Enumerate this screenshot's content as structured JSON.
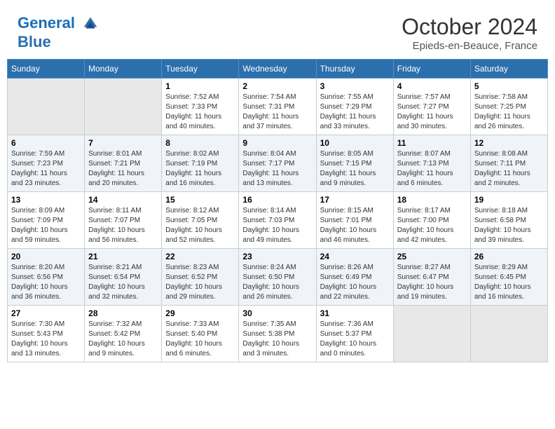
{
  "header": {
    "logo_line1": "General",
    "logo_line2": "Blue",
    "month": "October 2024",
    "location": "Epieds-en-Beauce, France"
  },
  "weekdays": [
    "Sunday",
    "Monday",
    "Tuesday",
    "Wednesday",
    "Thursday",
    "Friday",
    "Saturday"
  ],
  "weeks": [
    [
      {
        "day": "",
        "info": ""
      },
      {
        "day": "",
        "info": ""
      },
      {
        "day": "1",
        "info": "Sunrise: 7:52 AM\nSunset: 7:33 PM\nDaylight: 11 hours and 40 minutes."
      },
      {
        "day": "2",
        "info": "Sunrise: 7:54 AM\nSunset: 7:31 PM\nDaylight: 11 hours and 37 minutes."
      },
      {
        "day": "3",
        "info": "Sunrise: 7:55 AM\nSunset: 7:29 PM\nDaylight: 11 hours and 33 minutes."
      },
      {
        "day": "4",
        "info": "Sunrise: 7:57 AM\nSunset: 7:27 PM\nDaylight: 11 hours and 30 minutes."
      },
      {
        "day": "5",
        "info": "Sunrise: 7:58 AM\nSunset: 7:25 PM\nDaylight: 11 hours and 26 minutes."
      }
    ],
    [
      {
        "day": "6",
        "info": "Sunrise: 7:59 AM\nSunset: 7:23 PM\nDaylight: 11 hours and 23 minutes."
      },
      {
        "day": "7",
        "info": "Sunrise: 8:01 AM\nSunset: 7:21 PM\nDaylight: 11 hours and 20 minutes."
      },
      {
        "day": "8",
        "info": "Sunrise: 8:02 AM\nSunset: 7:19 PM\nDaylight: 11 hours and 16 minutes."
      },
      {
        "day": "9",
        "info": "Sunrise: 8:04 AM\nSunset: 7:17 PM\nDaylight: 11 hours and 13 minutes."
      },
      {
        "day": "10",
        "info": "Sunrise: 8:05 AM\nSunset: 7:15 PM\nDaylight: 11 hours and 9 minutes."
      },
      {
        "day": "11",
        "info": "Sunrise: 8:07 AM\nSunset: 7:13 PM\nDaylight: 11 hours and 6 minutes."
      },
      {
        "day": "12",
        "info": "Sunrise: 8:08 AM\nSunset: 7:11 PM\nDaylight: 11 hours and 2 minutes."
      }
    ],
    [
      {
        "day": "13",
        "info": "Sunrise: 8:09 AM\nSunset: 7:09 PM\nDaylight: 10 hours and 59 minutes."
      },
      {
        "day": "14",
        "info": "Sunrise: 8:11 AM\nSunset: 7:07 PM\nDaylight: 10 hours and 56 minutes."
      },
      {
        "day": "15",
        "info": "Sunrise: 8:12 AM\nSunset: 7:05 PM\nDaylight: 10 hours and 52 minutes."
      },
      {
        "day": "16",
        "info": "Sunrise: 8:14 AM\nSunset: 7:03 PM\nDaylight: 10 hours and 49 minutes."
      },
      {
        "day": "17",
        "info": "Sunrise: 8:15 AM\nSunset: 7:01 PM\nDaylight: 10 hours and 46 minutes."
      },
      {
        "day": "18",
        "info": "Sunrise: 8:17 AM\nSunset: 7:00 PM\nDaylight: 10 hours and 42 minutes."
      },
      {
        "day": "19",
        "info": "Sunrise: 8:18 AM\nSunset: 6:58 PM\nDaylight: 10 hours and 39 minutes."
      }
    ],
    [
      {
        "day": "20",
        "info": "Sunrise: 8:20 AM\nSunset: 6:56 PM\nDaylight: 10 hours and 36 minutes."
      },
      {
        "day": "21",
        "info": "Sunrise: 8:21 AM\nSunset: 6:54 PM\nDaylight: 10 hours and 32 minutes."
      },
      {
        "day": "22",
        "info": "Sunrise: 8:23 AM\nSunset: 6:52 PM\nDaylight: 10 hours and 29 minutes."
      },
      {
        "day": "23",
        "info": "Sunrise: 8:24 AM\nSunset: 6:50 PM\nDaylight: 10 hours and 26 minutes."
      },
      {
        "day": "24",
        "info": "Sunrise: 8:26 AM\nSunset: 6:49 PM\nDaylight: 10 hours and 22 minutes."
      },
      {
        "day": "25",
        "info": "Sunrise: 8:27 AM\nSunset: 6:47 PM\nDaylight: 10 hours and 19 minutes."
      },
      {
        "day": "26",
        "info": "Sunrise: 8:29 AM\nSunset: 6:45 PM\nDaylight: 10 hours and 16 minutes."
      }
    ],
    [
      {
        "day": "27",
        "info": "Sunrise: 7:30 AM\nSunset: 5:43 PM\nDaylight: 10 hours and 13 minutes."
      },
      {
        "day": "28",
        "info": "Sunrise: 7:32 AM\nSunset: 5:42 PM\nDaylight: 10 hours and 9 minutes."
      },
      {
        "day": "29",
        "info": "Sunrise: 7:33 AM\nSunset: 5:40 PM\nDaylight: 10 hours and 6 minutes."
      },
      {
        "day": "30",
        "info": "Sunrise: 7:35 AM\nSunset: 5:38 PM\nDaylight: 10 hours and 3 minutes."
      },
      {
        "day": "31",
        "info": "Sunrise: 7:36 AM\nSunset: 5:37 PM\nDaylight: 10 hours and 0 minutes."
      },
      {
        "day": "",
        "info": ""
      },
      {
        "day": "",
        "info": ""
      }
    ]
  ]
}
